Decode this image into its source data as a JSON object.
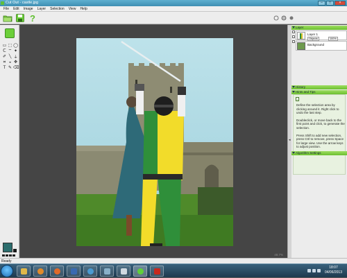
{
  "window": {
    "title": "Cut Out - castle.jpg"
  },
  "menu": [
    "File",
    "Edit",
    "Image",
    "Layer",
    "Selection",
    "View",
    "Help"
  ],
  "toolbar": {
    "buttons": [
      "open-folder",
      "save",
      "help"
    ]
  },
  "tools": [
    "select-rectangle-icon",
    "select-rounded-icon",
    "select-ellipse-icon",
    "lasso-icon",
    "polygon-lasso-icon",
    "magic-wand-icon",
    "brush-icon",
    "line-icon",
    "eyedropper-icon",
    "crop-icon",
    "paint-bucket-icon",
    "move-icon",
    "text-icon",
    "pencil-icon",
    "eraser-icon"
  ],
  "tool_glyphs": [
    "▭",
    "⬚",
    "◯",
    "ᑕ",
    "⌔",
    "✦",
    "✐",
    "╲",
    "⍊",
    "⌗",
    "◒",
    "✥",
    "T",
    "✎",
    "⌫"
  ],
  "colors": {
    "foreground": "#2c6e6e",
    "background": "#1a1a1a",
    "accent": "#6cbf2f"
  },
  "canvas": {
    "zoom": "48.7%"
  },
  "panels": {
    "layer": {
      "header": "Layer",
      "rows": [
        {
          "name": "Layer 1",
          "controls": [
            "Objects",
            "100%"
          ]
        },
        {
          "name": "Background"
        }
      ]
    },
    "history": {
      "header": "History"
    },
    "hints": {
      "header": "Hints and Tips",
      "icon": "i",
      "paragraphs": [
        "Define the selection area by clicking around it. Right click to undo the last step.",
        "Doubleclick, or move back to the first point and click, to generate the selection.",
        "Press Shift to add new selection, press Ctrl to remove, press Space for large view. Use the arrow keys to adjust position."
      ]
    },
    "algorithm": {
      "header": "Algorithm Settings"
    }
  },
  "splitter": {
    "arrow": "◂"
  },
  "status": {
    "text": "Ready"
  },
  "taskbar": {
    "apps": [
      "explorer-icon",
      "media-player-icon",
      "firefox-icon",
      "photo-viewer-icon",
      "network-icon",
      "application-icon",
      "scanner-icon",
      "cutout-icon",
      "pdf-reader-icon"
    ],
    "clock": {
      "time": "18:07",
      "date": "04/06/2013"
    }
  }
}
